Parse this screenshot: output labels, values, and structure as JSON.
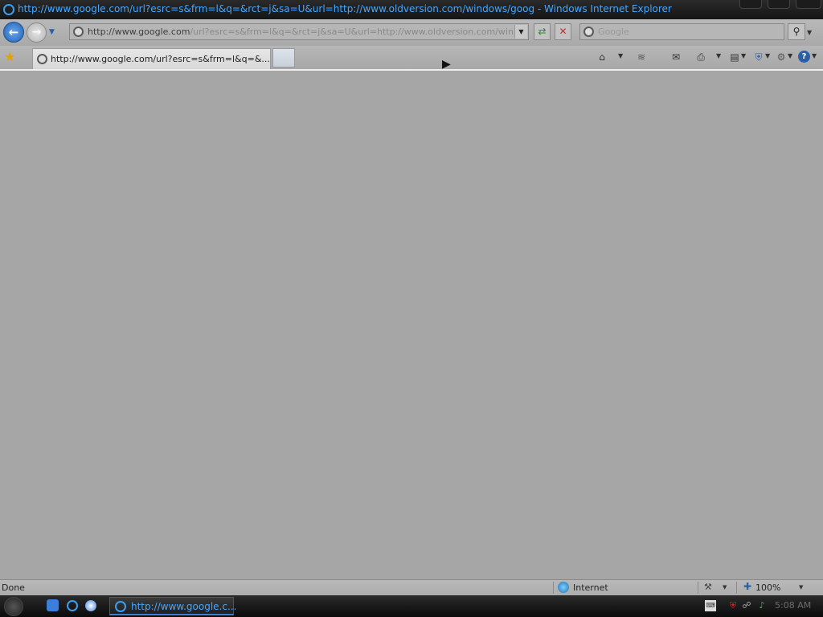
{
  "window": {
    "title": "http://www.google.com/url?esrc=s&frm=l&q=&rct=j&sa=U&url=http://www.oldversion.com/windows/goog - Windows Internet Explorer"
  },
  "navbar": {
    "address_host": "http://www.google.com",
    "address_rest": "/url?esrc=s&frm=l&q=&rct=j&sa=U&url=http://www.oldversion.com/wind",
    "search_placeholder": "Google"
  },
  "tabs": [
    {
      "label": "http://www.google.com/url?esrc=s&frm=l&q=&..."
    }
  ],
  "statusbar": {
    "status": "Done",
    "zone": "Internet",
    "zoom": "100%"
  },
  "taskbar": {
    "window_button": "http://www.google.c...",
    "clock": "5:08 AM"
  },
  "colors": {
    "title_text": "#46a6ff",
    "content_bg": "#a6a6a6",
    "taskbar_bg": "#151515"
  }
}
